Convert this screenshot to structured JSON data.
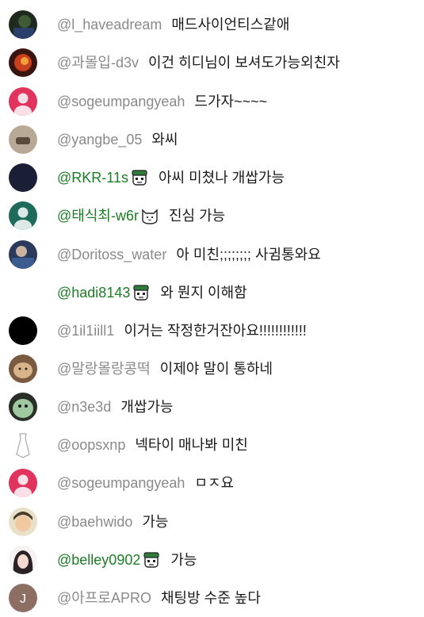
{
  "colors": {
    "author": "#8a8a8a",
    "member_author": "#1c7d26",
    "message": "#1a1a1a",
    "default_avatar_pink": "#e0345e",
    "default_avatar_teal": "#1e6b5b"
  },
  "messages": [
    {
      "author": "@l_haveadream",
      "member": false,
      "badge": "",
      "avatar": "photo-dark-green",
      "text": "매드사이언티스같애"
    },
    {
      "author": "@과몰입-d3v",
      "member": false,
      "badge": "",
      "avatar": "photo-red-orange",
      "text": "이건 히디님이 보셔도가능외친자"
    },
    {
      "author": "@sogeumpangyeah",
      "member": false,
      "badge": "",
      "avatar": "default-pink",
      "text": "드가자~~~~"
    },
    {
      "author": "@yangbe_05",
      "member": false,
      "badge": "",
      "avatar": "photo-beige",
      "text": "와씨"
    },
    {
      "author": "@RKR-11s",
      "member": true,
      "badge": "member-badge-icon",
      "avatar": "photo-navy",
      "text": "아씨 미쳤나 개쌉가능"
    },
    {
      "author": "@태식최-w6r",
      "member": true,
      "badge": "dog-badge-icon",
      "avatar": "default-teal",
      "text": "진심 가능"
    },
    {
      "author": "@Doritoss_water",
      "member": false,
      "badge": "",
      "avatar": "photo-person-blue",
      "text": "아 미친;;;;;;;; 사귐통와요"
    },
    {
      "author": "@hadi8143",
      "member": true,
      "badge": "member-badge-icon",
      "avatar": "none",
      "text": "와 뭔지 이해함"
    },
    {
      "author": "@1il1iill1",
      "member": false,
      "badge": "",
      "avatar": "photo-black",
      "text": "이거는 작정한거잔아요!!!!!!!!!!!!"
    },
    {
      "author": "@말랑몰랑콩떡",
      "member": false,
      "badge": "",
      "avatar": "photo-hamster",
      "text": "이제야 말이 통하네"
    },
    {
      "author": "@n3e3d",
      "member": false,
      "badge": "",
      "avatar": "photo-green-blob",
      "text": "개쌉가능"
    },
    {
      "author": "@oopsxnp",
      "member": false,
      "badge": "",
      "avatar": "photo-sketch",
      "text": "넥타이 매나봐 미친"
    },
    {
      "author": "@sogeumpangyeah",
      "member": false,
      "badge": "",
      "avatar": "default-pink",
      "text": "ㅁㅈ요"
    },
    {
      "author": "@baehwido",
      "member": false,
      "badge": "",
      "avatar": "photo-cartoon",
      "text": "가능"
    },
    {
      "author": "@belley0902",
      "member": true,
      "badge": "member-badge-icon",
      "avatar": "photo-anime",
      "text": "가능"
    },
    {
      "author": "@아프로APRO",
      "member": false,
      "badge": "",
      "avatar": "letter",
      "avatar_letter": "J",
      "text": "채팅방 수준 높다"
    }
  ]
}
